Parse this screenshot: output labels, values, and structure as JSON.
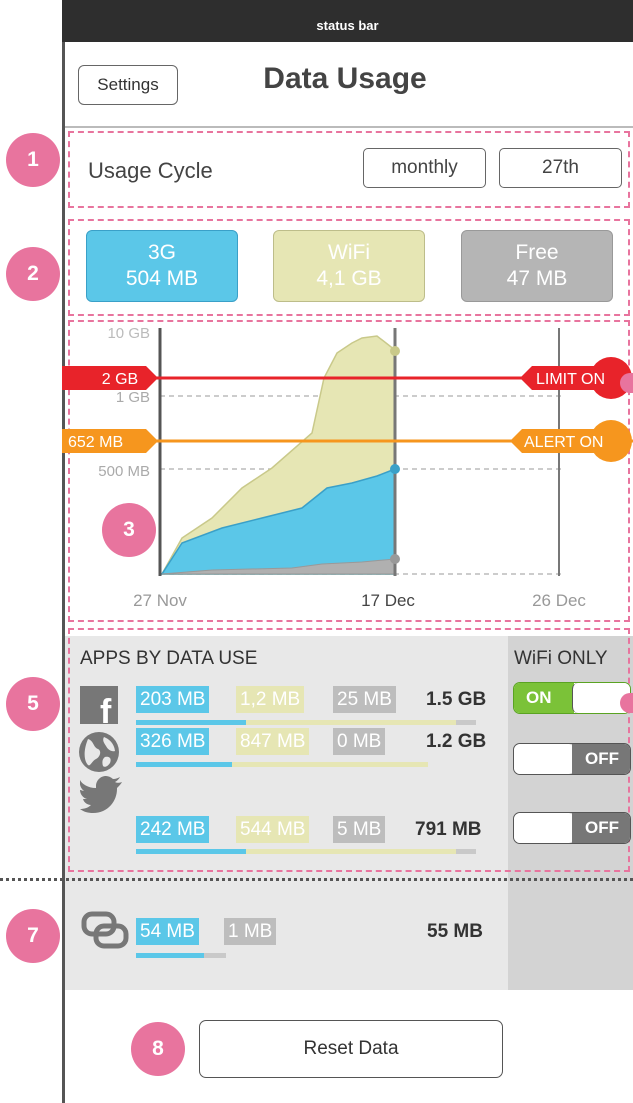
{
  "status_bar": {
    "label": "status bar"
  },
  "header": {
    "settings_label": "Settings",
    "title": "Data Usage"
  },
  "usage_cycle": {
    "label": "Usage Cycle",
    "period": "monthly",
    "day": "27th"
  },
  "usage_buttons": [
    {
      "name": "3G",
      "value": "504 MB",
      "color": "#5bc7e8"
    },
    {
      "name": "WiFi",
      "value": "4,1 GB",
      "color": "#e6e6b4"
    },
    {
      "name": "Free",
      "value": "47 MB",
      "color": "#b5b5b5"
    }
  ],
  "limits": {
    "limit_value": "2 GB",
    "limit_label": "LIMIT ON",
    "limit_color": "#e8232a",
    "alert_value": "652 MB",
    "alert_label": "ALERT ON",
    "alert_color": "#f6961e"
  },
  "chart_data": {
    "type": "area",
    "y_tick_labels": [
      "10 GB",
      "1 GB",
      "500 MB"
    ],
    "x_tick_labels": [
      "27 Nov",
      "17 Dec",
      "26 Dec"
    ],
    "series_colors": {
      "wifi": "#e6e6b4",
      "3g": "#5bc7e8",
      "free": "#b0b0b0"
    }
  },
  "apps_section": {
    "title": "APPS BY DATA USE",
    "wifi_only_title": "WiFi ONLY",
    "apps": [
      {
        "icon": "facebook-icon",
        "g3": "203 MB",
        "wifi": "1,2 MB",
        "free": "25 MB",
        "total": "1.5 GB",
        "wifi_only": "ON"
      },
      {
        "icon": "globe-icon",
        "g3": "326 MB",
        "wifi": "847 MB",
        "free": "0 MB",
        "total": "1.2 GB",
        "wifi_only": "OFF"
      },
      {
        "icon": "twitter-bird-icon",
        "g3": "242 MB",
        "wifi": "544 MB",
        "free": "5 MB",
        "total": "791 MB",
        "wifi_only": "OFF"
      }
    ]
  },
  "system_row": {
    "icon": "link-icon",
    "g3": "54 MB",
    "free": "1 MB",
    "total": "55 MB"
  },
  "reset_label": "Reset Data",
  "markers": [
    "1",
    "2",
    "3",
    "5",
    "7",
    "8"
  ]
}
